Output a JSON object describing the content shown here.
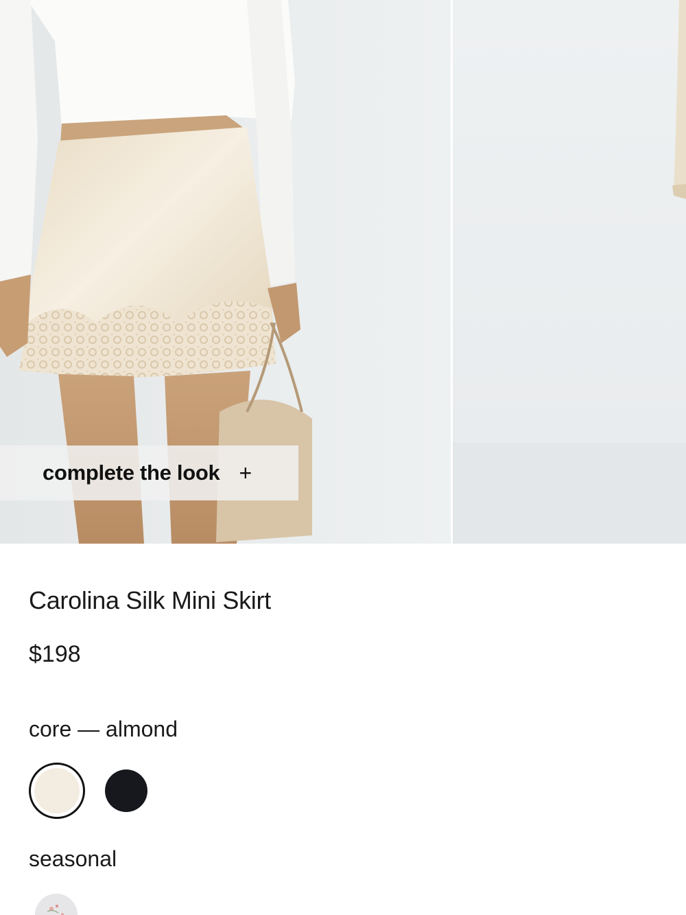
{
  "gallery": {
    "complete_look_label": "complete the look",
    "complete_look_icon": "+",
    "background_color": "#e9eced"
  },
  "product": {
    "title": "Carolina Silk Mini Skirt",
    "price": "$198"
  },
  "colors": {
    "core_label": "core — almond",
    "core_swatches": [
      {
        "name": "almond",
        "hex": "#f3ece0",
        "selected": true
      },
      {
        "name": "black",
        "hex": "#16181d",
        "selected": false
      }
    ],
    "seasonal_label": "seasonal",
    "seasonal_swatch_icon": "floral-print-swatch"
  }
}
